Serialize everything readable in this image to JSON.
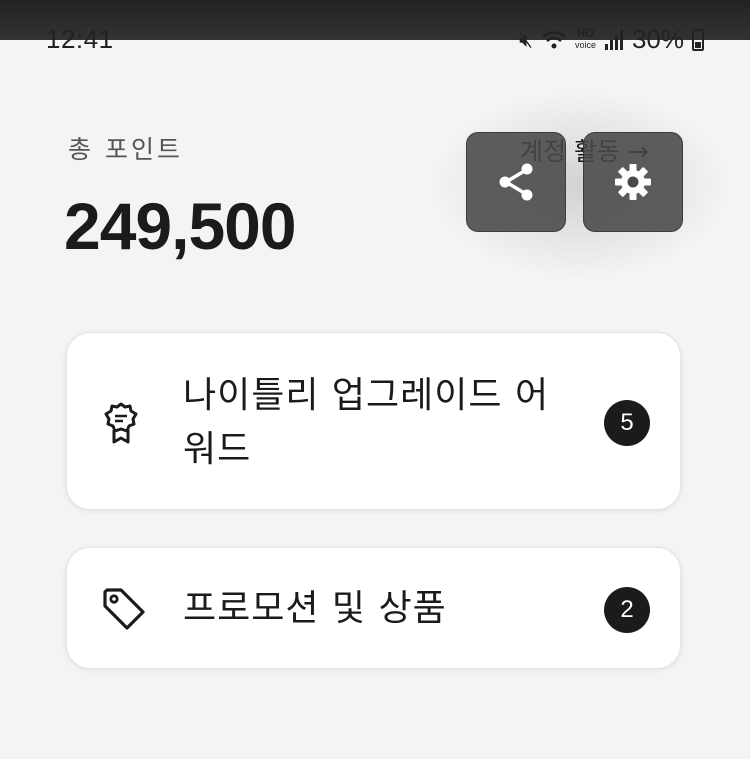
{
  "status_bar": {
    "time": "12:41",
    "hd_label": "HD",
    "voice_label": "voice",
    "battery": "30%",
    "icons": [
      "mute-icon",
      "wifi-icon",
      "signal-icon",
      "battery-icon"
    ]
  },
  "points": {
    "label": "총 포인트",
    "value": "249,500"
  },
  "account_link": {
    "label": "계정 활동",
    "arrow": "→"
  },
  "overlay_buttons": [
    {
      "icon": "share-icon"
    },
    {
      "icon": "gear-icon"
    }
  ],
  "cards": [
    {
      "icon": "award-ribbon-icon",
      "title": "나이틀리 업그레이드 어워드",
      "count": "5"
    },
    {
      "icon": "tag-icon",
      "title": "프로모션 및 상품",
      "count": "2"
    }
  ],
  "colors": {
    "background": "#f4f4f4",
    "card": "#ffffff",
    "badge": "#1b1b1b",
    "overlay_button": "#484848"
  }
}
